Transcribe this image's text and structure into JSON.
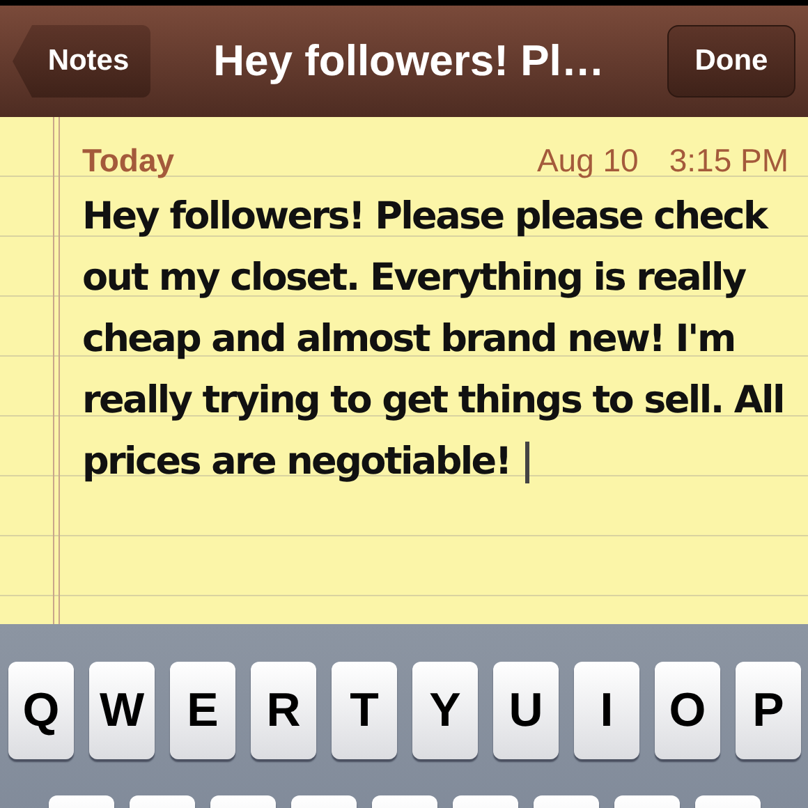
{
  "nav_bar": {
    "back_button": "Notes",
    "title": "Hey followers! Pl…",
    "done_button": "Done"
  },
  "note": {
    "day": "Today",
    "date": "Aug 10",
    "time": "3:15 PM",
    "body": "Hey followers! Please please check out my closet. Everything is really cheap and almost brand new! I'm really trying to get things to sell. All prices are negotiable!"
  },
  "keyboard": {
    "top_row": [
      "Q",
      "W",
      "E",
      "R",
      "T",
      "Y",
      "U",
      "I",
      "O",
      "P"
    ]
  }
}
